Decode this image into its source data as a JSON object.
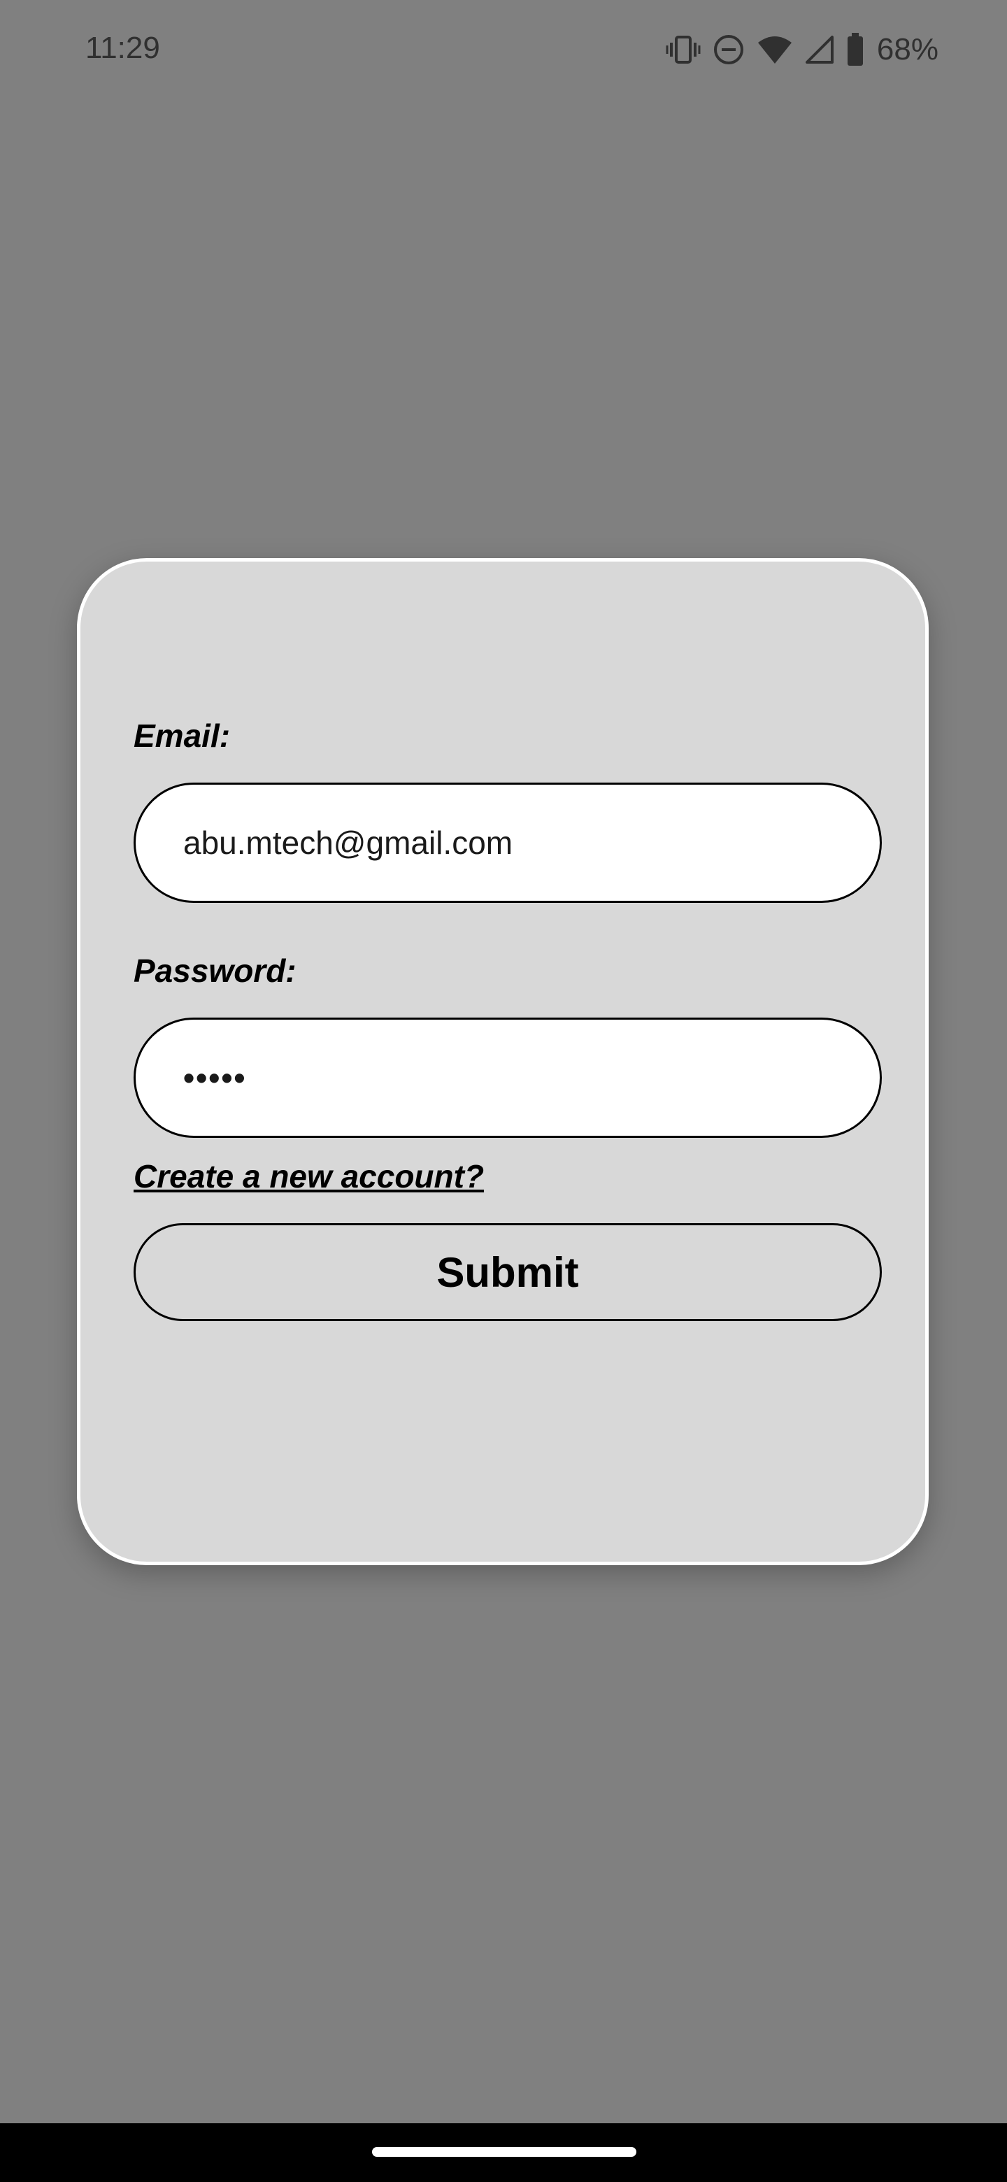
{
  "status_bar": {
    "time": "11:29",
    "battery_percent": "68%",
    "icons": [
      "vibrate-icon",
      "do-not-disturb-icon",
      "wifi-icon",
      "cell-signal-icon",
      "battery-icon"
    ]
  },
  "login_form": {
    "email_label": "Email:",
    "email_value": "abu.mtech@gmail.com",
    "password_label": "Password:",
    "password_value": "•••••",
    "create_account_link": "Create a new account?",
    "submit_label": "Submit"
  },
  "colors": {
    "background": "#808080",
    "card": "#d8d8d8",
    "input": "#ffffff",
    "text": "#000000"
  }
}
